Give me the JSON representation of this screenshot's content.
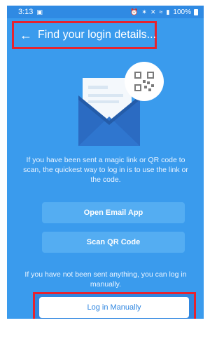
{
  "status_bar": {
    "time": "3:13",
    "battery_text": "100%",
    "colors": {
      "bar": "#2f8ae3"
    }
  },
  "header": {
    "title": "Find your login details...",
    "back_icon": "arrow-left-icon"
  },
  "illustration": {
    "icons": [
      "envelope-icon",
      "qr-code-icon",
      "letter-icon"
    ]
  },
  "content": {
    "info_text": "If you have been sent a magic link or QR code to scan, the quickest way to log in is to use the link or the code.",
    "open_email_label": "Open Email App",
    "scan_qr_label": "Scan QR Code",
    "manual_info_text": "If you have not been sent anything, you can log in manually.",
    "log_in_manually_label": "Log in Manually"
  },
  "colors": {
    "background": "#3a9bed",
    "button": "#54adf2",
    "highlight_border": "#e5232f",
    "manual_button_text": "#2f86e0"
  }
}
